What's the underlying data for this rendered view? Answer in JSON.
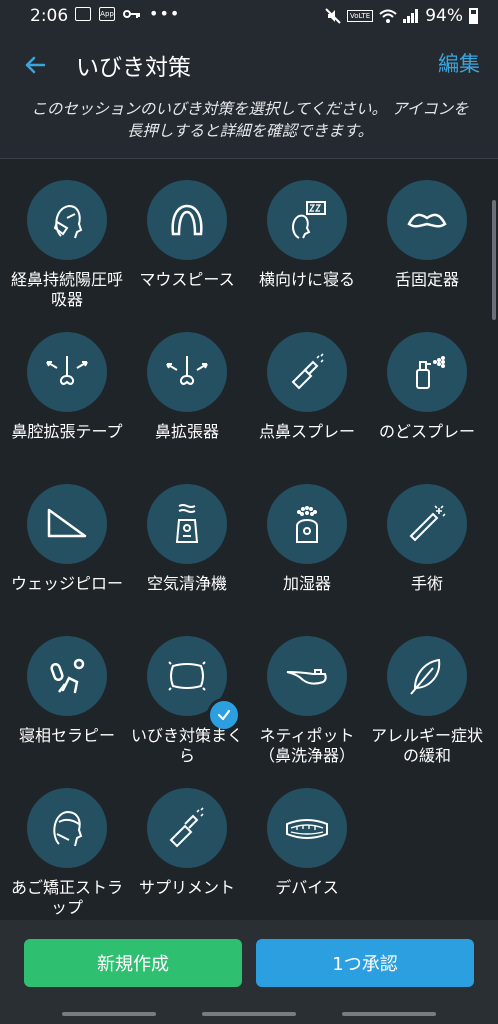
{
  "status_bar": {
    "time": "2:06",
    "battery": "94%",
    "icons": [
      "gallery-icon",
      "app-icon",
      "key-icon",
      "more-dots-icon",
      "mute-icon",
      "volte-icon",
      "wifi-icon",
      "signal-icon",
      "battery-icon"
    ],
    "volte_label": "VoLTE",
    "app_label": "App"
  },
  "header": {
    "title": "いびき対策",
    "edit": "編集",
    "instruction": "このセッションのいびき対策を選択してください。 アイコンを長押しすると詳細を確認できます。"
  },
  "remedies": [
    {
      "label": "経鼻持続陽圧呼吸器",
      "icon": "cpap-mask-icon",
      "selected": false
    },
    {
      "label": "マウスピース",
      "icon": "mouthpiece-icon",
      "selected": false
    },
    {
      "label": "横向けに寝る",
      "icon": "side-sleep-icon",
      "selected": false
    },
    {
      "label": "舌固定器",
      "icon": "tongue-retainer-icon",
      "selected": false
    },
    {
      "label": "鼻腔拡張テープ",
      "icon": "nasal-strip-icon",
      "selected": false
    },
    {
      "label": "鼻拡張器",
      "icon": "nasal-dilator-icon",
      "selected": false
    },
    {
      "label": "点鼻スプレー",
      "icon": "nasal-spray-icon",
      "selected": false
    },
    {
      "label": "のどスプレー",
      "icon": "throat-spray-icon",
      "selected": false
    },
    {
      "label": "ウェッジピロー",
      "icon": "wedge-pillow-icon",
      "selected": false
    },
    {
      "label": "空気清浄機",
      "icon": "air-purifier-icon",
      "selected": false
    },
    {
      "label": "加湿器",
      "icon": "humidifier-icon",
      "selected": false
    },
    {
      "label": "手術",
      "icon": "surgery-wand-icon",
      "selected": false
    },
    {
      "label": "寝相セラピー",
      "icon": "positional-therapy-icon",
      "selected": false
    },
    {
      "label": "いびき対策まくら",
      "icon": "anti-snore-pillow-icon",
      "selected": true
    },
    {
      "label": "ネティポット（鼻洗浄器）",
      "icon": "neti-pot-icon",
      "selected": false
    },
    {
      "label": "アレルギー症状の緩和",
      "icon": "allergy-feather-icon",
      "selected": false
    },
    {
      "label": "あご矯正ストラップ",
      "icon": "chin-strap-icon",
      "selected": false
    },
    {
      "label": "サプリメント",
      "icon": "supplement-icon",
      "selected": false
    },
    {
      "label": "デバイス",
      "icon": "device-icon",
      "selected": false
    }
  ],
  "actions": {
    "new": "新規作成",
    "approve": "1つ承認"
  },
  "colors": {
    "background": "#1f2429",
    "icon_circle": "#245061",
    "accent_blue": "#2c9fe0",
    "accent_green": "#2fbf71",
    "edit_link": "#3aa5dc"
  }
}
